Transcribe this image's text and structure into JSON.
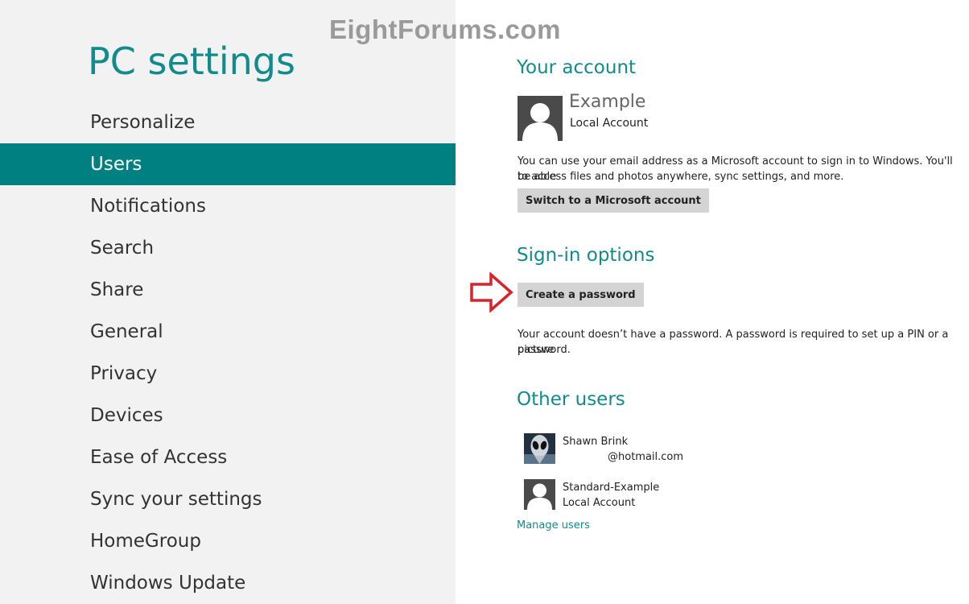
{
  "watermark": "EightForums.com",
  "sidebar": {
    "title": "PC settings",
    "items": [
      {
        "label": "Personalize"
      },
      {
        "label": "Users"
      },
      {
        "label": "Notifications"
      },
      {
        "label": "Search"
      },
      {
        "label": "Share"
      },
      {
        "label": "General"
      },
      {
        "label": "Privacy"
      },
      {
        "label": "Devices"
      },
      {
        "label": "Ease of Access"
      },
      {
        "label": "Sync your settings"
      },
      {
        "label": "HomeGroup"
      },
      {
        "label": "Windows Update"
      }
    ],
    "selected": "Users"
  },
  "your_account": {
    "heading": "Your account",
    "name": "Example",
    "type": "Local Account",
    "description_line1": "You can use your email address as a Microsoft account to sign in to Windows. You'll be able",
    "description_line2": "to access files and photos anywhere, sync settings, and more.",
    "switch_button": "Switch to a Microsoft account"
  },
  "sign_in": {
    "heading": "Sign-in options",
    "create_password_button": "Create a password",
    "note_line1": "Your account doesn’t have a password. A password is required to set up a PIN or a picture",
    "note_line2": "password."
  },
  "other_users": {
    "heading": "Other users",
    "users": [
      {
        "name": "Shawn Brink",
        "detail": "@hotmail.com"
      },
      {
        "name": "Standard-Example",
        "detail": "Local Account"
      }
    ],
    "manage_link": "Manage users"
  },
  "colors": {
    "accent": "#008080",
    "heading": "#118b8b",
    "sidebar_bg": "#f2f2f2",
    "button_bg": "#d4d4d4",
    "arrow": "#d9232a"
  }
}
